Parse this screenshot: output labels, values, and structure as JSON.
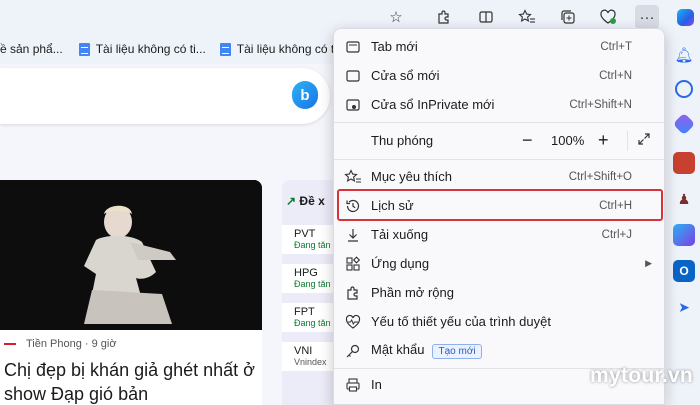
{
  "toolbar": {
    "icons": [
      "star-icon",
      "extensions-icon",
      "split-screen-icon",
      "favorites-icon",
      "collections-icon",
      "browser-essentials-icon",
      "menu-icon",
      "copilot-icon"
    ]
  },
  "bookmarks": [
    {
      "label": "ề sản phẩ..."
    },
    {
      "label": "Tài liệu không có ti..."
    },
    {
      "label": "Tài liệu không có ti..."
    }
  ],
  "news": {
    "source": "Tiền Phong · 9 giờ",
    "title": "Chị đẹp bị khán giả ghét nhất ở show Đạp gió bản"
  },
  "stocks": {
    "heading": "Đề x",
    "items": [
      {
        "symbol": "PVT",
        "status": "Đang tăn"
      },
      {
        "symbol": "HPG",
        "status": "Đang tăn"
      },
      {
        "symbol": "FPT",
        "status": "Đang tăn"
      },
      {
        "symbol": "VNI",
        "status": "Vnindex"
      }
    ]
  },
  "menu": {
    "new_tab": {
      "label": "Tab mới",
      "shortcut": "Ctrl+T"
    },
    "new_window": {
      "label": "Cửa sổ mới",
      "shortcut": "Ctrl+N"
    },
    "inprivate": {
      "label": "Cửa sổ InPrivate mới",
      "shortcut": "Ctrl+Shift+N"
    },
    "zoom": {
      "label": "Thu phóng",
      "value": "100%",
      "minus": "−",
      "plus": "+"
    },
    "favorites": {
      "label": "Mục yêu thích",
      "shortcut": "Ctrl+Shift+O"
    },
    "history": {
      "label": "Lịch sử",
      "shortcut": "Ctrl+H"
    },
    "downloads": {
      "label": "Tải xuống",
      "shortcut": "Ctrl+J"
    },
    "apps": {
      "label": "Ứng dụng"
    },
    "extensions": {
      "label": "Phần mở rộng"
    },
    "essentials": {
      "label": "Yếu tố thiết yếu của trình duyệt"
    },
    "passwords": {
      "label": "Mật khẩu",
      "badge": "Tạo mới"
    },
    "print": {
      "label": "In"
    }
  },
  "watermark": "mytour.vn",
  "colors": {
    "highlight": "#d8333a",
    "accent": "#1a73e8"
  }
}
